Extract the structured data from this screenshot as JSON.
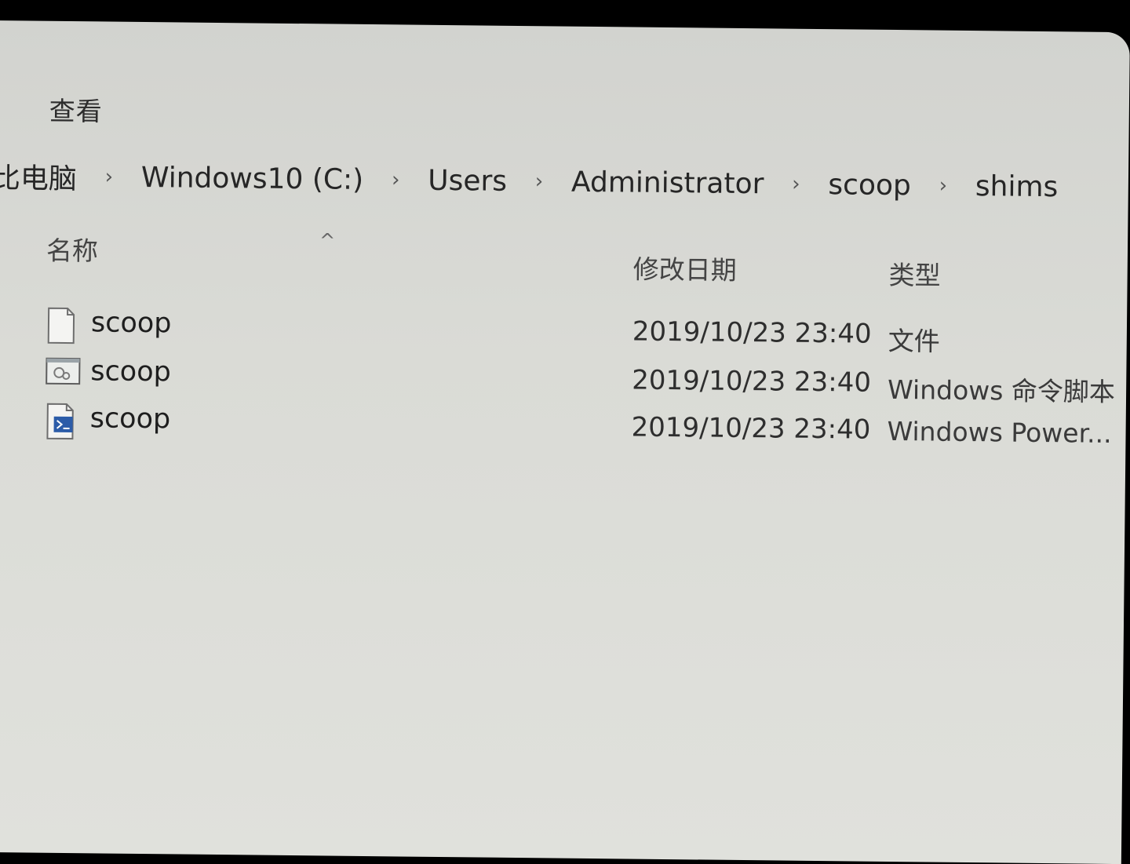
{
  "ribbon": {
    "tab_view": "查看"
  },
  "breadcrumb": {
    "items": [
      "比电脑",
      "Windows10 (C:)",
      "Users",
      "Administrator",
      "scoop",
      "shims"
    ],
    "separator": "›"
  },
  "columns": {
    "name": "名称",
    "date": "修改日期",
    "type": "类型",
    "sort_indicator": "^"
  },
  "files": [
    {
      "name": "scoop",
      "date": "2019/10/23 23:40",
      "type": "文件",
      "icon": "blank-file-icon"
    },
    {
      "name": "scoop",
      "date": "2019/10/23 23:40",
      "type": "Windows 命令脚本",
      "icon": "cmd-script-icon"
    },
    {
      "name": "scoop",
      "date": "2019/10/23 23:40",
      "type": "Windows Power...",
      "icon": "powershell-script-icon"
    }
  ]
}
